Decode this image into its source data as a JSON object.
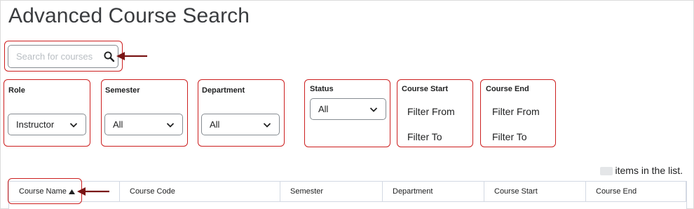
{
  "page": {
    "title": "Advanced Course Search"
  },
  "search": {
    "placeholder": "Search for courses",
    "value": "",
    "icon": "search-icon"
  },
  "filters": {
    "role": {
      "label": "Role",
      "value": "Instructor"
    },
    "semester": {
      "label": "Semester",
      "value": "All"
    },
    "department": {
      "label": "Department",
      "value": "All"
    },
    "status": {
      "label": "Status",
      "value": "All"
    },
    "course_start": {
      "label": "Course Start",
      "from": "Filter From",
      "to": "Filter To"
    },
    "course_end": {
      "label": "Course End",
      "from": "Filter From",
      "to": "Filter To"
    }
  },
  "list": {
    "items_suffix": "items in the list."
  },
  "table": {
    "columns": [
      {
        "label": "Course Name",
        "sort": "ascending"
      },
      {
        "label": "Course Code"
      },
      {
        "label": "Semester"
      },
      {
        "label": "Department"
      },
      {
        "label": "Course Start"
      },
      {
        "label": "Course End"
      }
    ]
  },
  "colors": {
    "annotation": "#cc1f1f",
    "arrow": "#7a1515",
    "border": "#868c92",
    "grid": "#d3d9e3"
  }
}
